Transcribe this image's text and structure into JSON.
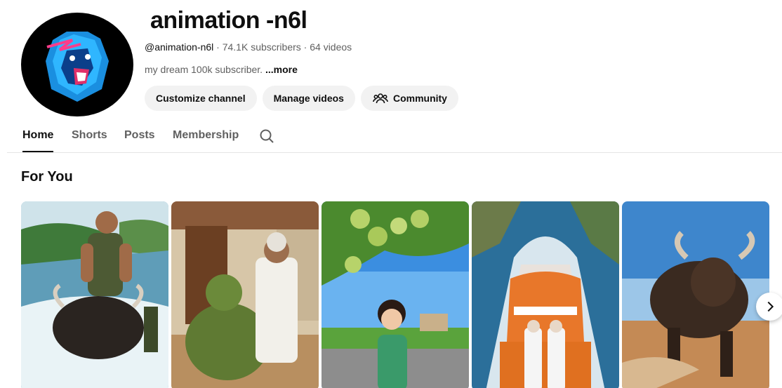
{
  "channel": {
    "title": "animation -n6l",
    "handle": "@animation-n6l",
    "subscribers": "74.1K subscribers",
    "videos": "64 videos",
    "separator": " · ",
    "description": "my dream 100k subscriber.",
    "more_label": "...more"
  },
  "actions": {
    "customize_label": "Customize channel",
    "manage_label": "Manage videos",
    "community_label": "Community"
  },
  "tabs": [
    {
      "label": "Home",
      "active": true
    },
    {
      "label": "Shorts",
      "active": false
    },
    {
      "label": "Posts",
      "active": false
    },
    {
      "label": "Membership",
      "active": false
    }
  ],
  "section": {
    "title": "For You"
  },
  "icons": {
    "avatar": "blue-lion-logo",
    "community": "people-icon",
    "search": "search-icon",
    "next": "chevron-right-icon"
  },
  "shorts": [
    {
      "scene": "soldier riding buffalo in river"
    },
    {
      "scene": "green giant with old man at village house"
    },
    {
      "scene": "girl under guava tree"
    },
    {
      "scene": "elderly couple on pumpkin boat"
    },
    {
      "scene": "charging buffalo in desert"
    }
  ]
}
